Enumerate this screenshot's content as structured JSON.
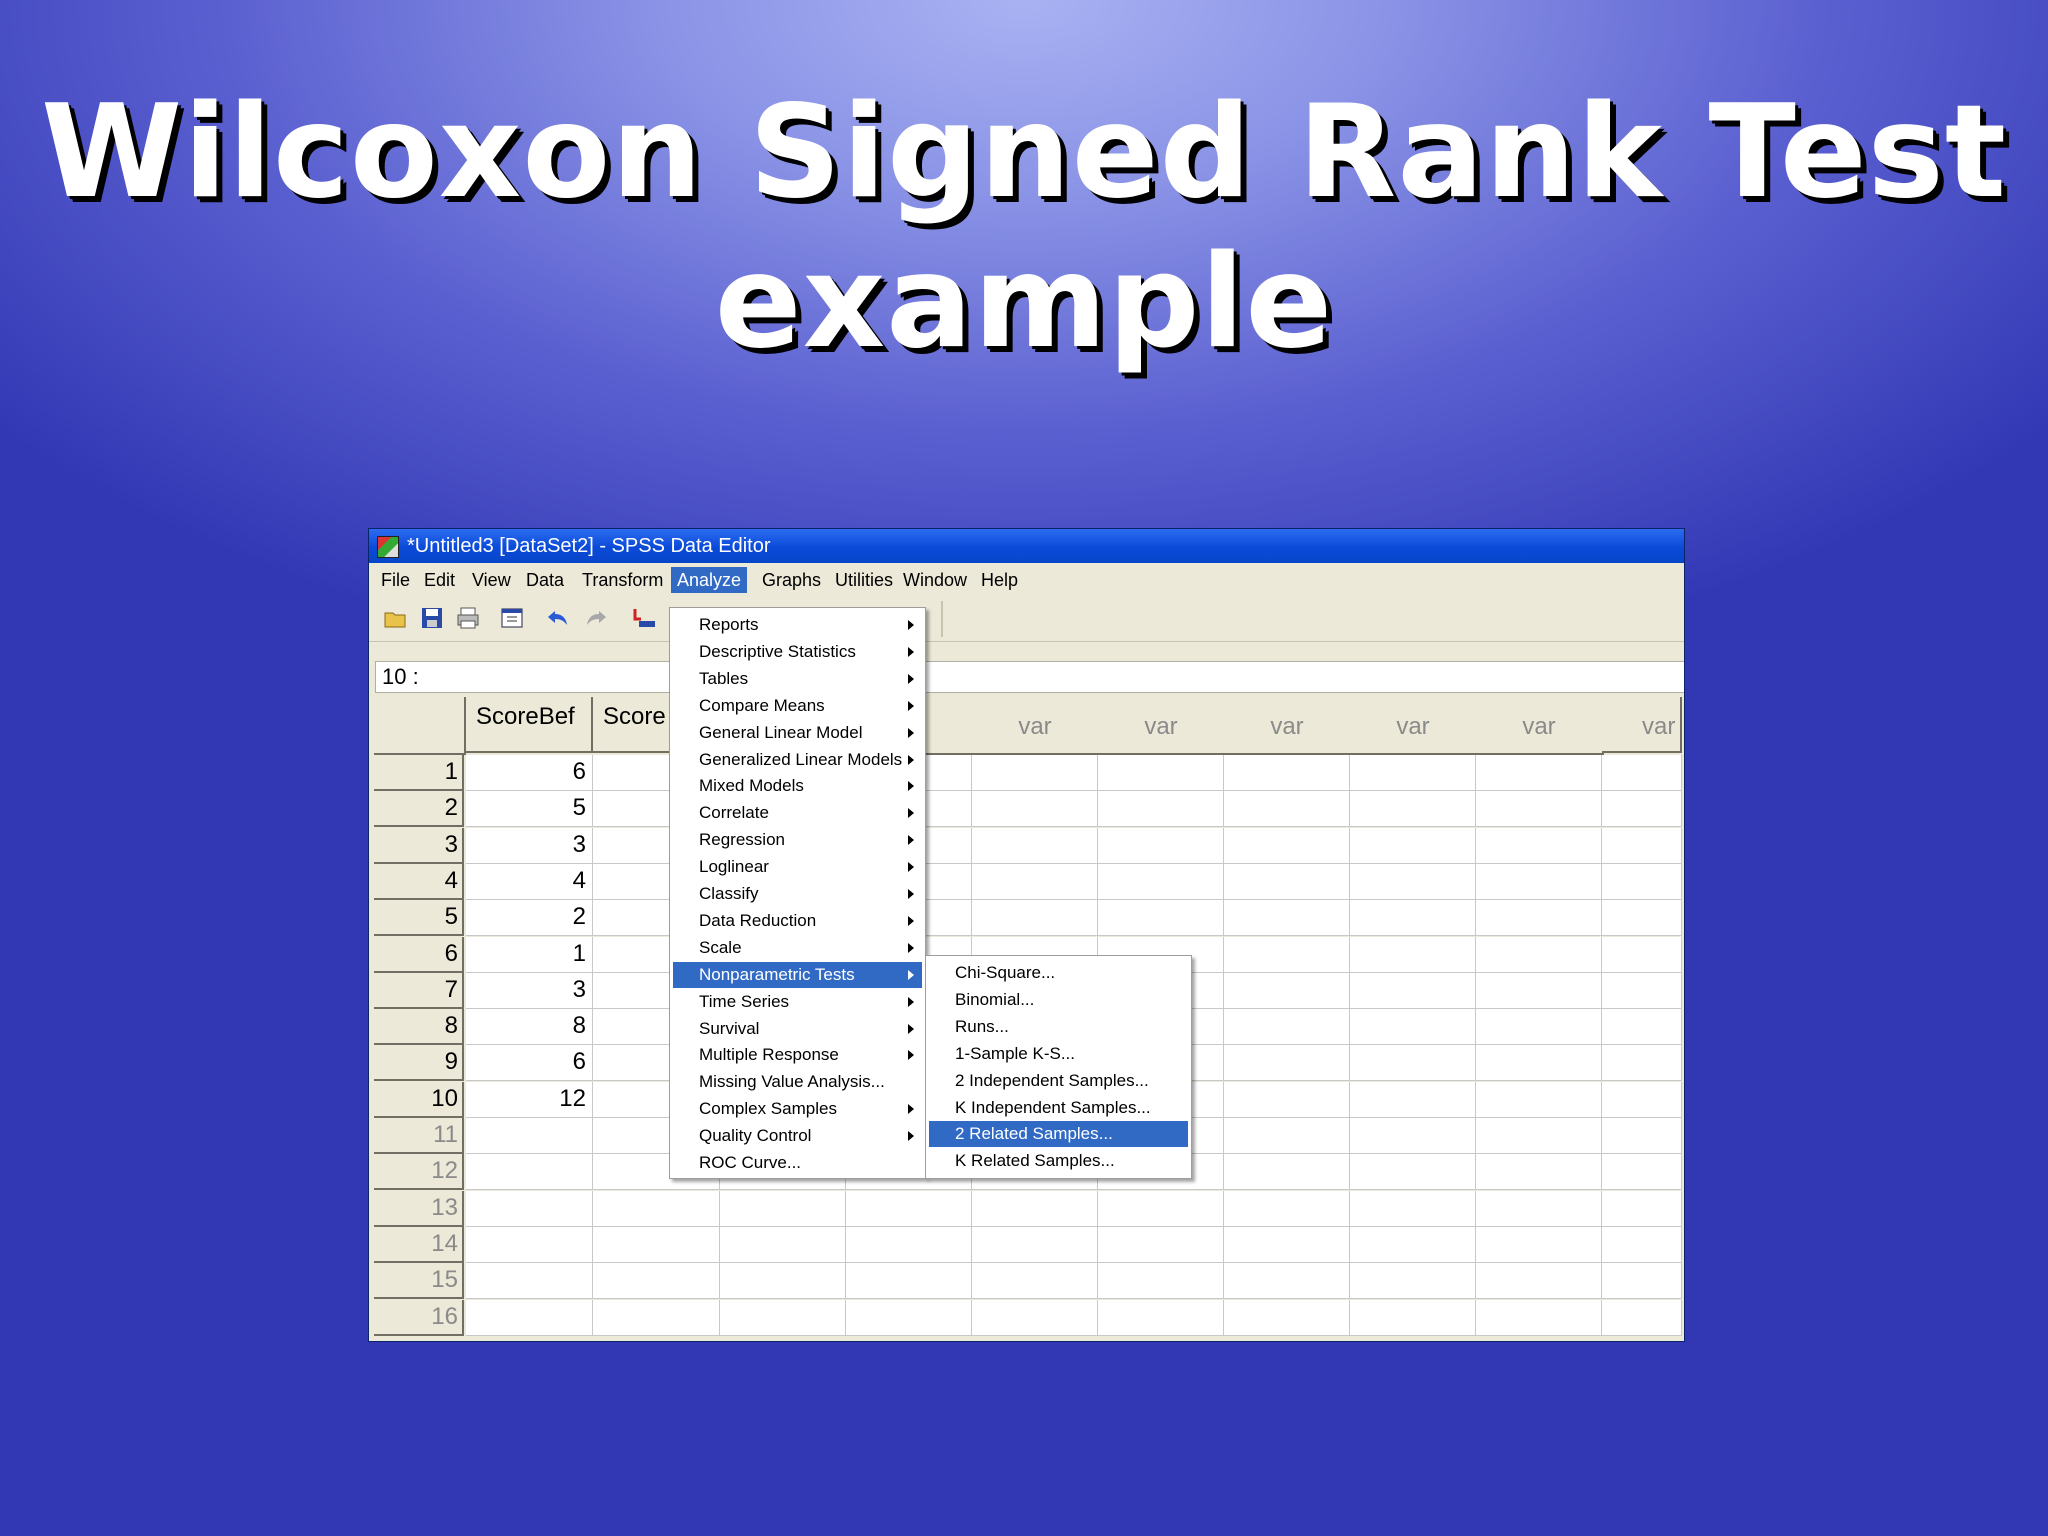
{
  "slide": {
    "title_line1": "Wilcoxon Signed Rank Test",
    "title_line2": "example"
  },
  "window": {
    "title": "*Untitled3 [DataSet2] - SPSS Data Editor"
  },
  "menubar": [
    "File",
    "Edit",
    "View",
    "Data",
    "Transform",
    "Analyze",
    "Graphs",
    "Utilities",
    "Window",
    "Help"
  ],
  "cell_ref": "10 :",
  "columns": {
    "col1": "ScoreBef",
    "col2": "Score",
    "var": "var",
    "var_partial": "var"
  },
  "rows": [
    "1",
    "2",
    "3",
    "4",
    "5",
    "6",
    "7",
    "8",
    "9",
    "10",
    "11",
    "12",
    "13",
    "14",
    "15",
    "16"
  ],
  "scorebef": [
    "6",
    "5",
    "3",
    "4",
    "2",
    "1",
    "3",
    "8",
    "6",
    "12"
  ],
  "analyze_menu": [
    {
      "label": "Reports",
      "submenu": true
    },
    {
      "label": "Descriptive Statistics",
      "submenu": true
    },
    {
      "label": "Tables",
      "submenu": true
    },
    {
      "label": "Compare Means",
      "submenu": true
    },
    {
      "label": "General Linear Model",
      "submenu": true
    },
    {
      "label": "Generalized Linear Models",
      "submenu": true
    },
    {
      "label": "Mixed Models",
      "submenu": true
    },
    {
      "label": "Correlate",
      "submenu": true
    },
    {
      "label": "Regression",
      "submenu": true
    },
    {
      "label": "Loglinear",
      "submenu": true
    },
    {
      "label": "Classify",
      "submenu": true
    },
    {
      "label": "Data Reduction",
      "submenu": true
    },
    {
      "label": "Scale",
      "submenu": true
    },
    {
      "label": "Nonparametric Tests",
      "submenu": true,
      "active": true
    },
    {
      "label": "Time Series",
      "submenu": true
    },
    {
      "label": "Survival",
      "submenu": true
    },
    {
      "label": "Multiple Response",
      "submenu": true
    },
    {
      "label": "Missing Value Analysis...",
      "submenu": false
    },
    {
      "label": "Complex Samples",
      "submenu": true
    },
    {
      "label": "Quality Control",
      "submenu": true
    },
    {
      "label": "ROC Curve...",
      "submenu": false
    }
  ],
  "nonparametric_menu": [
    {
      "label": "Chi-Square..."
    },
    {
      "label": "Binomial..."
    },
    {
      "label": "Runs..."
    },
    {
      "label": "1-Sample K-S..."
    },
    {
      "label": "2 Independent Samples..."
    },
    {
      "label": "K Independent Samples..."
    },
    {
      "label": "2 Related Samples...",
      "active": true
    },
    {
      "label": "K Related Samples..."
    }
  ],
  "colors": {
    "highlight": "#316ac5",
    "titlebar": "#0a4ad8"
  }
}
